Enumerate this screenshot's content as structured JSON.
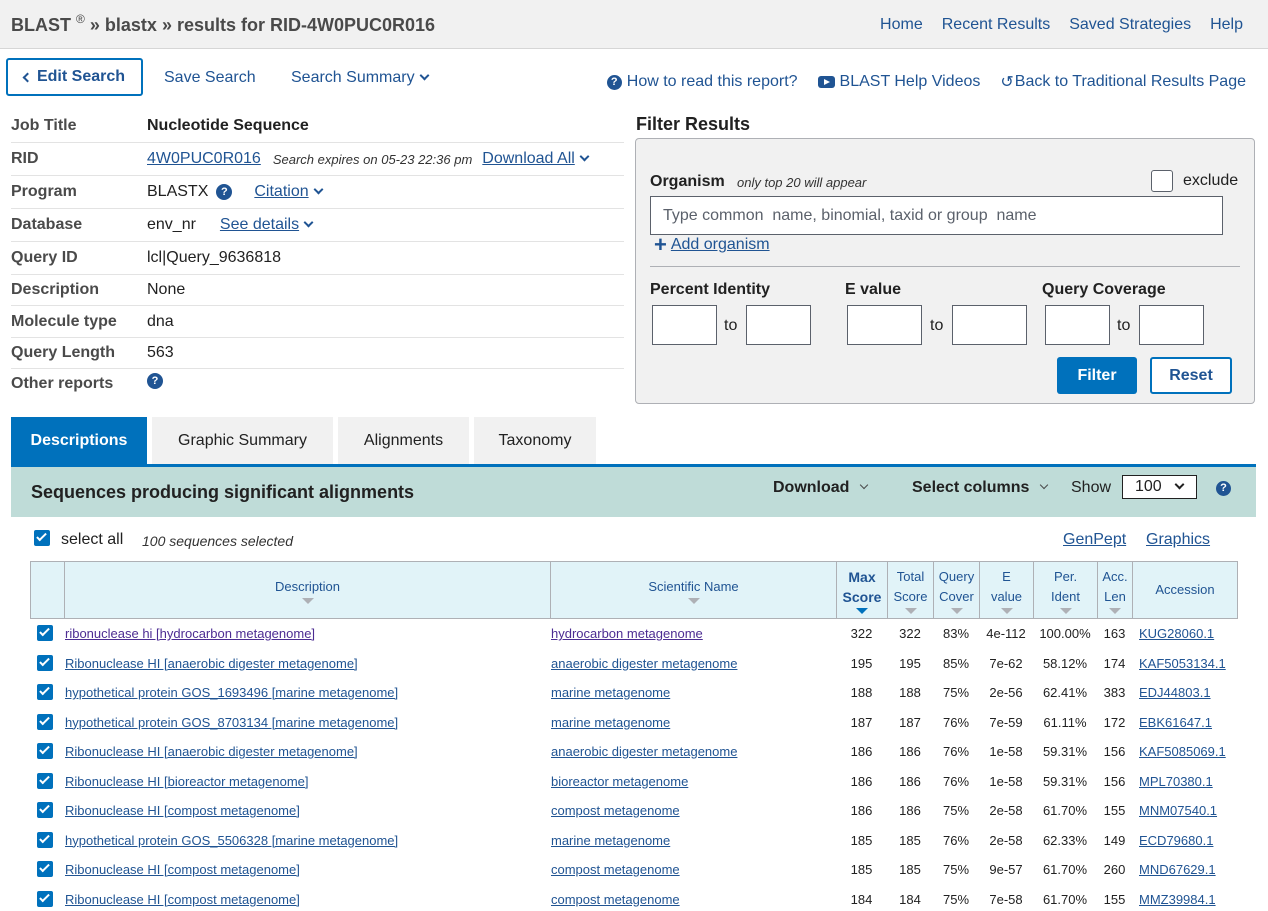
{
  "breadcrumb": {
    "blast": "BLAST",
    "reg": "®",
    "sep1": "»",
    "program": "blastx",
    "sep2": "»",
    "results": "results for RID-4W0PUC0R016"
  },
  "topnav": [
    "Home",
    "Recent Results",
    "Saved Strategies",
    "Help"
  ],
  "actions": {
    "edit_search": "Edit Search",
    "save_search": "Save Search",
    "search_summary": "Search Summary",
    "how_to_read": "How to read this report?",
    "help_videos": "BLAST Help Videos",
    "back_traditional": "Back to Traditional Results Page"
  },
  "job": {
    "labels": {
      "title": "Job Title",
      "rid": "RID",
      "program": "Program",
      "database": "Database",
      "query_id": "Query ID",
      "description": "Description",
      "molecule": "Molecule type",
      "length": "Query Length",
      "other": "Other reports"
    },
    "title": "Nucleotide Sequence",
    "rid": "4W0PUC0R016",
    "expires": "Search expires on 05-23 22:36 pm",
    "download_all": "Download All",
    "program": "BLASTX",
    "citation": "Citation",
    "database": "env_nr",
    "see_details": "See details",
    "query_id": "lcl|Query_9636818",
    "description": "None",
    "molecule": "dna",
    "length": "563"
  },
  "filter": {
    "title": "Filter Results",
    "organism_label": "Organism",
    "organism_note": "only top 20 will appear",
    "exclude_label": "exclude",
    "organism_placeholder": "Type common  name, binomial, taxid or group  name",
    "add_organism": "Add organism",
    "percent_identity": "Percent Identity",
    "e_value": "E value",
    "query_coverage": "Query Coverage",
    "to": "to",
    "filter_btn": "Filter",
    "reset_btn": "Reset"
  },
  "tabs": [
    "Descriptions",
    "Graphic Summary",
    "Alignments",
    "Taxonomy"
  ],
  "results": {
    "title": "Sequences producing significant alignments",
    "download": "Download",
    "select_columns": "Select columns",
    "show": "Show",
    "show_value": "100",
    "select_all": "select all",
    "selected_count": "100 sequences selected",
    "genpept": "GenPept",
    "graphics": "Graphics",
    "columns": {
      "description": "Description",
      "scientific": "Scientific Name",
      "max1": "Max",
      "max2": "Score",
      "total1": "Total",
      "total2": "Score",
      "qc1": "Query",
      "qc2": "Cover",
      "ev1": "E",
      "ev2": "value",
      "pi1": "Per.",
      "pi2": "Ident",
      "al1": "Acc.",
      "al2": "Len",
      "accession": "Accession"
    },
    "rows": [
      {
        "desc": "ribonuclease hi [hydrocarbon metagenome]",
        "sci": "hydrocarbon metagenome",
        "max": "322",
        "total": "322",
        "cover": "83%",
        "evalue": "4e-112",
        "ident": "100.00%",
        "len": "163",
        "acc": "KUG28060.1"
      },
      {
        "desc": "Ribonuclease HI [anaerobic digester metagenome]",
        "sci": "anaerobic digester metagenome",
        "max": "195",
        "total": "195",
        "cover": "85%",
        "evalue": "7e-62",
        "ident": "58.12%",
        "len": "174",
        "acc": "KAF5053134.1"
      },
      {
        "desc": "hypothetical protein GOS_1693496 [marine metagenome]",
        "sci": "marine metagenome",
        "max": "188",
        "total": "188",
        "cover": "75%",
        "evalue": "2e-56",
        "ident": "62.41%",
        "len": "383",
        "acc": "EDJ44803.1"
      },
      {
        "desc": "hypothetical protein GOS_8703134 [marine metagenome]",
        "sci": "marine metagenome",
        "max": "187",
        "total": "187",
        "cover": "76%",
        "evalue": "7e-59",
        "ident": "61.11%",
        "len": "172",
        "acc": "EBK61647.1"
      },
      {
        "desc": "Ribonuclease HI [anaerobic digester metagenome]",
        "sci": "anaerobic digester metagenome",
        "max": "186",
        "total": "186",
        "cover": "76%",
        "evalue": "1e-58",
        "ident": "59.31%",
        "len": "156",
        "acc": "KAF5085069.1"
      },
      {
        "desc": "Ribonuclease HI [bioreactor metagenome]",
        "sci": "bioreactor metagenome",
        "max": "186",
        "total": "186",
        "cover": "76%",
        "evalue": "1e-58",
        "ident": "59.31%",
        "len": "156",
        "acc": "MPL70380.1"
      },
      {
        "desc": "Ribonuclease HI [compost metagenome]",
        "sci": "compost metagenome",
        "max": "186",
        "total": "186",
        "cover": "75%",
        "evalue": "2e-58",
        "ident": "61.70%",
        "len": "155",
        "acc": "MNM07540.1"
      },
      {
        "desc": "hypothetical protein GOS_5506328 [marine metagenome]",
        "sci": "marine metagenome",
        "max": "185",
        "total": "185",
        "cover": "76%",
        "evalue": "2e-58",
        "ident": "62.33%",
        "len": "149",
        "acc": "ECD79680.1"
      },
      {
        "desc": "Ribonuclease HI [compost metagenome]",
        "sci": "compost metagenome",
        "max": "185",
        "total": "185",
        "cover": "75%",
        "evalue": "9e-57",
        "ident": "61.70%",
        "len": "260",
        "acc": "MND67629.1"
      },
      {
        "desc": "Ribonuclease HI [compost metagenome]",
        "sci": "compost metagenome",
        "max": "184",
        "total": "184",
        "cover": "75%",
        "evalue": "7e-58",
        "ident": "61.70%",
        "len": "155",
        "acc": "MMZ39984.1"
      }
    ]
  },
  "colors": {
    "link": "#205493",
    "primary": "#0071bc",
    "results_bar": "#bfdcd8",
    "table_header": "#e1f3f8"
  },
  "icons": [
    "question-circle-icon",
    "youtube-icon",
    "back-arrow-icon",
    "chevron-left-icon",
    "chevron-down-icon",
    "plus-icon",
    "checkbox-checked-icon",
    "sort-caret-icon"
  ]
}
